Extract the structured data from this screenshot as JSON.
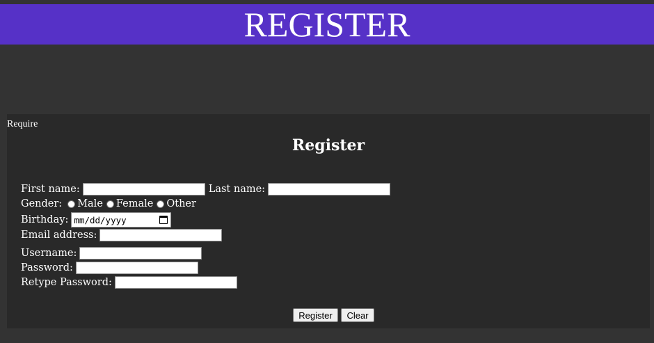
{
  "banner": {
    "title": "REGISTER"
  },
  "form": {
    "require_text": "Require",
    "title": "Register",
    "first_name_label": "First name:",
    "first_name_value": "",
    "last_name_label": "Last name:",
    "last_name_value": "",
    "gender_label": "Gender:",
    "gender_options": [
      "Male",
      "Female",
      "Other"
    ],
    "birthday_label": "Birthday:",
    "birthday_placeholder": "mm/dd/yyyy",
    "email_label": "Email address:",
    "email_value": "",
    "username_label": "Username:",
    "username_value": "",
    "password_label": "Password:",
    "password_value": "",
    "retype_password_label": "Retype Password:",
    "retype_password_value": "",
    "register_button": "Register",
    "clear_button": "Clear"
  },
  "colors": {
    "page_background": "#333333",
    "panel_background": "#292929",
    "banner_background": "#5631c7",
    "text": "#ffffff"
  },
  "icons": {
    "calendar": "calendar-icon"
  }
}
